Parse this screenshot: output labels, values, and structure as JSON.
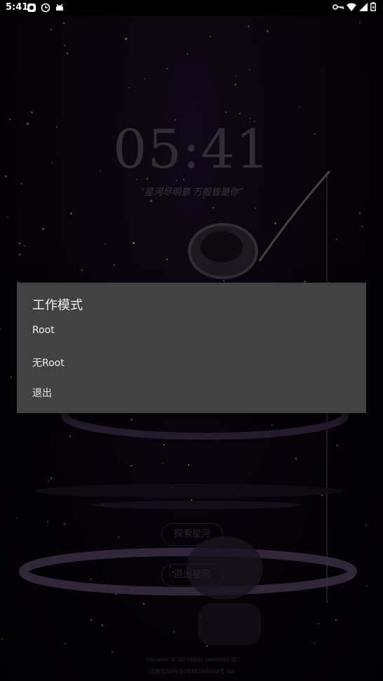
{
  "status_bar": {
    "time": "5:41",
    "left_icons": [
      "notification-app-icon",
      "clock-icon",
      "android-icon"
    ],
    "right_icons": [
      "vpn-key-icon",
      "wifi-icon",
      "signal-icon",
      "battery-icon"
    ]
  },
  "background": {
    "clock": "05:41",
    "quote": "“星河尽明意  万般皆是你”",
    "explore_button": "探索星河",
    "exit_button": "退出星河",
    "footer_line1": "Capable © All rights reserved 版",
    "footer_line2": "运营号SHN@2848594668号 aa"
  },
  "dialog": {
    "title": "工作模式",
    "options": [
      "Root",
      "无Root",
      "退出"
    ]
  }
}
